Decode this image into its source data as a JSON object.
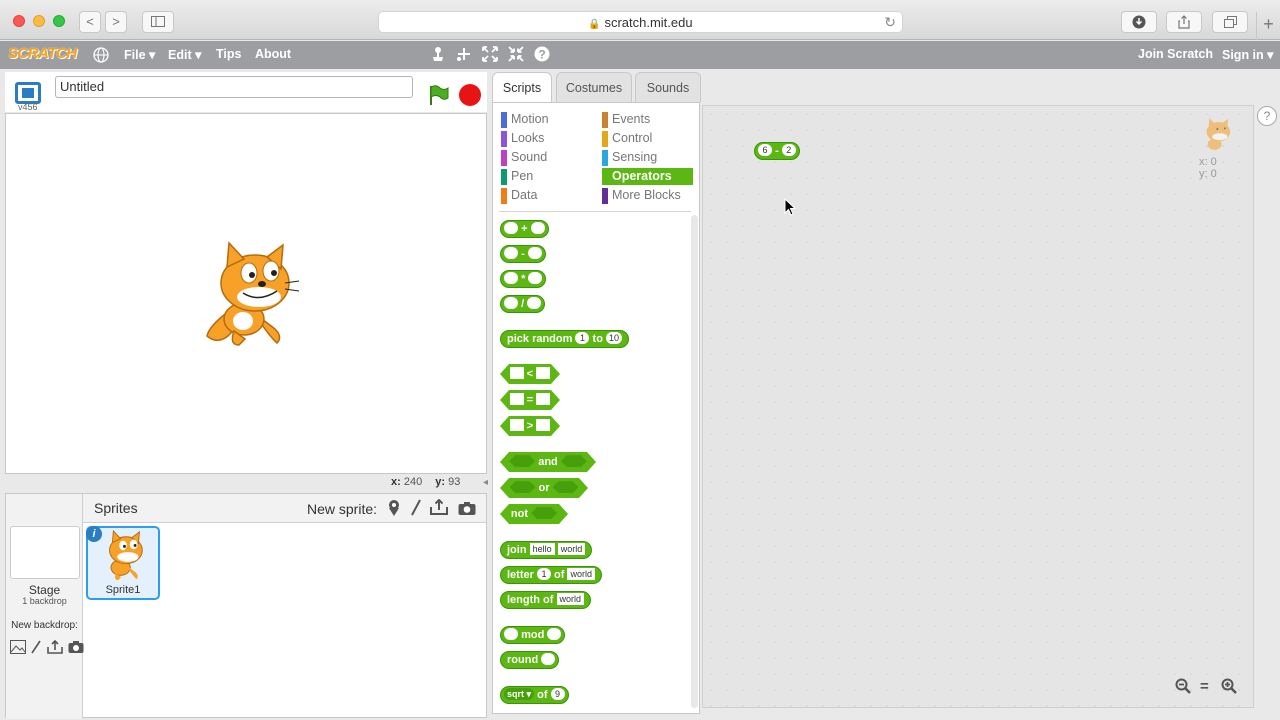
{
  "browser": {
    "url": "scratch.mit.edu",
    "back": "<",
    "forward": ">",
    "new_tab": "+"
  },
  "menubar": {
    "logo": "SCRATCH",
    "items": [
      "File ▾",
      "Edit ▾",
      "Tips",
      "About"
    ],
    "join": "Join Scratch",
    "sign_in": "Sign in ▾"
  },
  "stage": {
    "version": "v456",
    "project_title": "Untitled",
    "coords": {
      "x_label": "x:",
      "x": "240",
      "y_label": "y:",
      "y": "93"
    }
  },
  "sprites_pane": {
    "title": "Sprites",
    "new_sprite": "New sprite:",
    "stage_label": "Stage",
    "stage_backdrops": "1 backdrop",
    "new_backdrop": "New backdrop:",
    "sprite_name": "Sprite1",
    "info_badge": "i"
  },
  "tabs": [
    "Scripts",
    "Costumes",
    "Sounds"
  ],
  "categories": {
    "left": [
      {
        "label": "Motion",
        "color": "#4a6cd4"
      },
      {
        "label": "Looks",
        "color": "#8a55d7"
      },
      {
        "label": "Sound",
        "color": "#bb42c3"
      },
      {
        "label": "Pen",
        "color": "#0e9a6c"
      },
      {
        "label": "Data",
        "color": "#ee7d16"
      }
    ],
    "right": [
      {
        "label": "Events",
        "color": "#c88330"
      },
      {
        "label": "Control",
        "color": "#e1a91a"
      },
      {
        "label": "Sensing",
        "color": "#2ca5e2"
      },
      {
        "label": "Operators",
        "color": "#5cb712"
      },
      {
        "label": "More Blocks",
        "color": "#632d99"
      }
    ],
    "selected": "Operators"
  },
  "blocks": {
    "plus": "+",
    "minus": "-",
    "times": "*",
    "divide": "/",
    "pick_random": {
      "a": "pick  random",
      "from": "1",
      "to_label": "to",
      "to": "10"
    },
    "lt": "<",
    "eq": "=",
    "gt": ">",
    "and": "and",
    "or": "or",
    "not": "not",
    "join": {
      "label": "join",
      "a": "hello",
      "b": "world"
    },
    "letter": {
      "label": "letter",
      "n": "1",
      "of": "of",
      "s": "world"
    },
    "length": {
      "label": "length  of",
      "s": "world"
    },
    "mod": "mod",
    "round": "round",
    "sqrt": {
      "fn": "sqrt",
      "of": "of",
      "n": "9"
    }
  },
  "script_area": {
    "block": {
      "a": "6",
      "op": "-",
      "b": "2"
    },
    "sprite_x": "x: 0",
    "sprite_y": "y: 0",
    "zoom_out": "−",
    "zoom_reset": "=",
    "zoom_in": "+",
    "help": "?"
  }
}
